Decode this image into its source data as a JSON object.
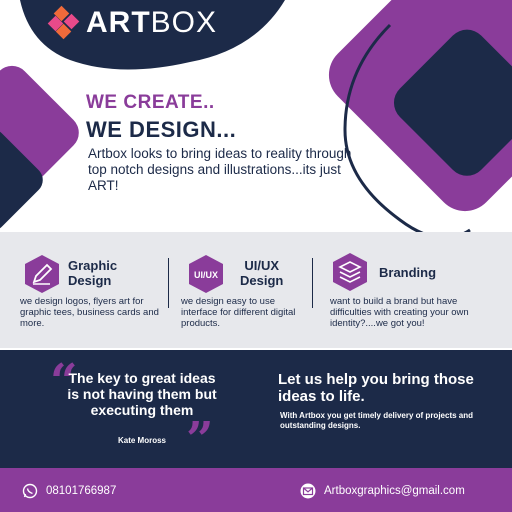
{
  "colors": {
    "purple": "#8a3c9a",
    "navy": "#1c2a48",
    "light_band": "#e7e8ec",
    "logo_orange": "#f06a3a",
    "logo_pink": "#e84a8a"
  },
  "brand": {
    "name_bold": "ART",
    "name_light": "BOX"
  },
  "hero": {
    "headline_line1": "WE CREATE..",
    "headline_line2": "WE DESIGN...",
    "intro": "Artbox looks to bring ideas to reality through top notch designs and illustrations...its just ART!"
  },
  "services": [
    {
      "icon": "pen-hexagon-icon",
      "title_line1": "Graphic",
      "title_line2": "Design",
      "icon_label": "",
      "description": "we design logos, flyers art for graphic tees, business cards and more."
    },
    {
      "icon": "uiux-hexagon-icon",
      "title_line1": "UI/UX",
      "title_line2": "Design",
      "icon_label": "UI/UX",
      "description": "we design easy to use interface for different digital products."
    },
    {
      "icon": "layers-hexagon-icon",
      "title_line1": "Branding",
      "title_line2": "",
      "icon_label": "",
      "description": "want to build a brand but have difficulties with creating your own identity?....we got you!"
    }
  ],
  "quote": {
    "text": "The key to great ideas is not having them but executing them",
    "author": "Kate Moross",
    "open_mark": "“",
    "close_mark": "”"
  },
  "help": {
    "title": "Let us help you bring those ideas to life.",
    "subtitle": "With Artbox you get timely delivery of projects and  outstanding designs."
  },
  "contact": {
    "phone": "08101766987",
    "phone_icon": "whatsapp-icon",
    "email": "Artboxgraphics@gmail.com",
    "email_icon": "mail-icon"
  }
}
